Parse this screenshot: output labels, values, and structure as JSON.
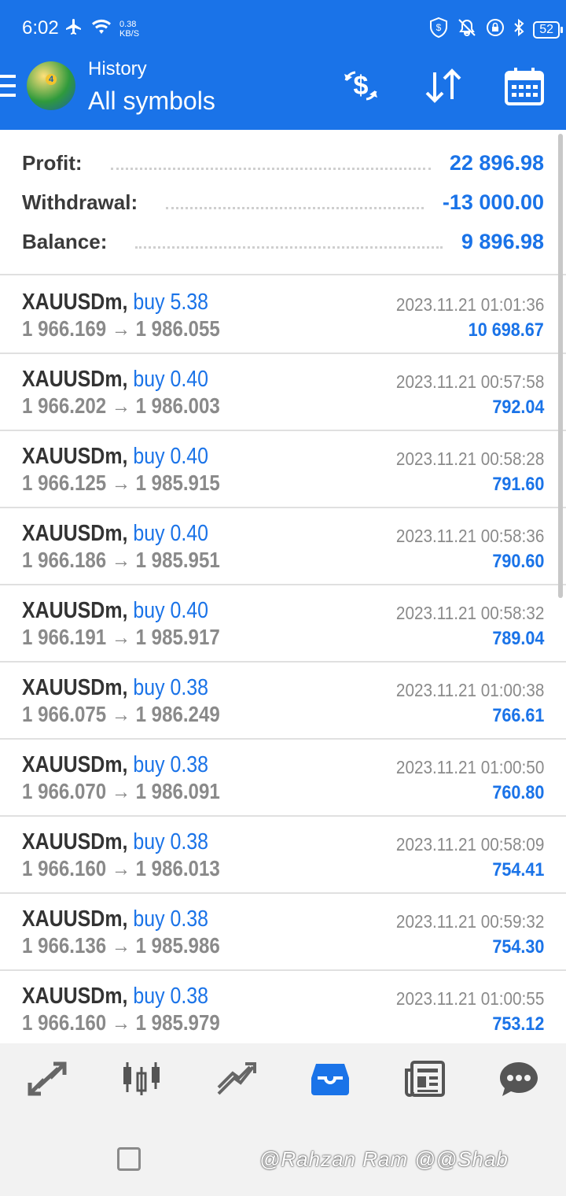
{
  "status_bar": {
    "time": "6:02",
    "net_speed_value": "0.38",
    "net_speed_unit": "KB/S",
    "battery": "52"
  },
  "header": {
    "subtitle": "History",
    "title": "All symbols"
  },
  "summary": {
    "profit_label": "Profit:",
    "profit_value": "22 896.98",
    "withdrawal_label": "Withdrawal:",
    "withdrawal_value": "-13 000.00",
    "balance_label": "Balance:",
    "balance_value": "9 896.98"
  },
  "deals": [
    {
      "symbol": "XAUUSDm,",
      "side": "buy 5.38",
      "open": "1 966.169",
      "close": "1 986.055",
      "time": "2023.11.21 01:01:36",
      "profit": "10 698.67"
    },
    {
      "symbol": "XAUUSDm,",
      "side": "buy 0.40",
      "open": "1 966.202",
      "close": "1 986.003",
      "time": "2023.11.21 00:57:58",
      "profit": "792.04"
    },
    {
      "symbol": "XAUUSDm,",
      "side": "buy 0.40",
      "open": "1 966.125",
      "close": "1 985.915",
      "time": "2023.11.21 00:58:28",
      "profit": "791.60"
    },
    {
      "symbol": "XAUUSDm,",
      "side": "buy 0.40",
      "open": "1 966.186",
      "close": "1 985.951",
      "time": "2023.11.21 00:58:36",
      "profit": "790.60"
    },
    {
      "symbol": "XAUUSDm,",
      "side": "buy 0.40",
      "open": "1 966.191",
      "close": "1 985.917",
      "time": "2023.11.21 00:58:32",
      "profit": "789.04"
    },
    {
      "symbol": "XAUUSDm,",
      "side": "buy 0.38",
      "open": "1 966.075",
      "close": "1 986.249",
      "time": "2023.11.21 01:00:38",
      "profit": "766.61"
    },
    {
      "symbol": "XAUUSDm,",
      "side": "buy 0.38",
      "open": "1 966.070",
      "close": "1 986.091",
      "time": "2023.11.21 01:00:50",
      "profit": "760.80"
    },
    {
      "symbol": "XAUUSDm,",
      "side": "buy 0.38",
      "open": "1 966.160",
      "close": "1 986.013",
      "time": "2023.11.21 00:58:09",
      "profit": "754.41"
    },
    {
      "symbol": "XAUUSDm,",
      "side": "buy 0.38",
      "open": "1 966.136",
      "close": "1 985.986",
      "time": "2023.11.21 00:59:32",
      "profit": "754.30"
    },
    {
      "symbol": "XAUUSDm,",
      "side": "buy 0.38",
      "open": "1 966.160",
      "close": "1 985.979",
      "time": "2023.11.21 01:00:55",
      "profit": "753.12"
    }
  ],
  "bottom_nav": [
    "quotes-icon",
    "chart-icon",
    "trade-icon",
    "history-icon",
    "news-icon",
    "chat-icon"
  ],
  "bottom_nav_active": "history-icon",
  "colors": {
    "accent": "#1a73e8",
    "muted": "#8a8a8a",
    "text": "#333333"
  },
  "watermark": "@Rahzan Ram @@Shab"
}
